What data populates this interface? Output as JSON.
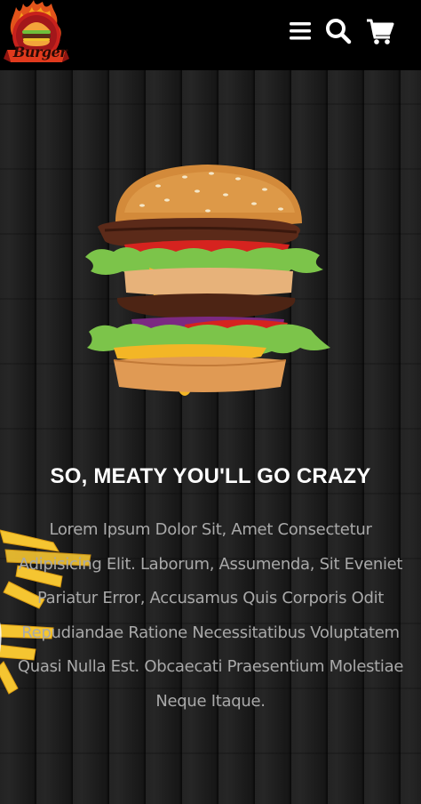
{
  "header": {
    "logo_text": "Burger",
    "icons": [
      "menu-icon",
      "search-icon",
      "cart-icon"
    ],
    "background_color": "#000000"
  },
  "hero": {
    "title": "SO, MEATY YOU'LL GO CRAZY",
    "description": "Lorem Ipsum Dolor Sit, Amet Consectetur Adipisicing Elit. Laborum, Assumenda, Sit Eveniet Pariatur Error, Accusamus Quis Corporis Odit Repudiandae Ratione Necessitatibus Voluptatem Quasi Nulla Est. Obcaecati Praesentium Molestiae Neque Itaque.",
    "title_color": "#ffffff",
    "text_color": "#a9a9a9"
  }
}
